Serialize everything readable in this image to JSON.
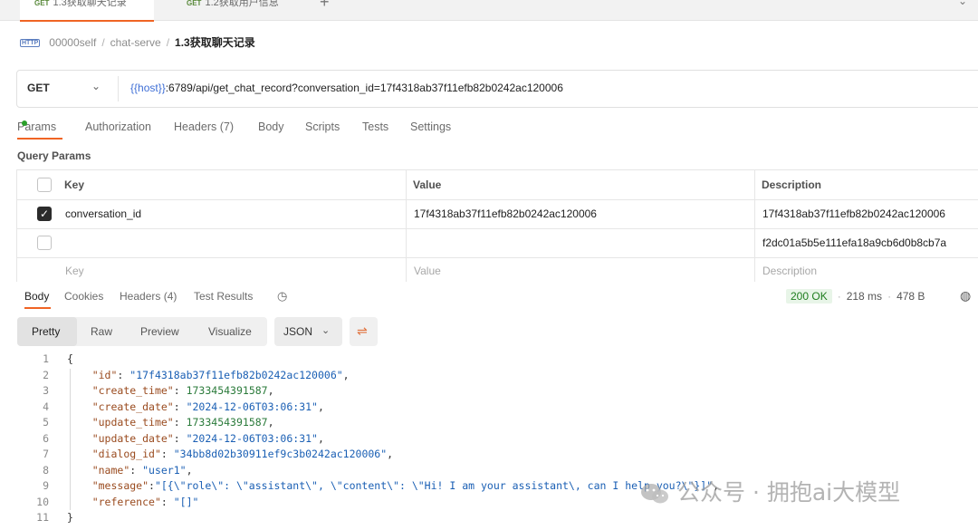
{
  "tabs": [
    {
      "method": "GET",
      "label": "1.3获取聊天记录",
      "active": true
    },
    {
      "method": "GET",
      "label": "1.2获取用户信息",
      "active": false
    }
  ],
  "breadcrumb": {
    "badge": "HTTP",
    "workspace": "00000self",
    "collection": "chat-serve",
    "current": "1.3获取聊天记录",
    "separator": "/"
  },
  "request": {
    "method": "GET",
    "url_var": "{{host}}",
    "url_rest": ":6789/api/get_chat_record?conversation_id=17f4318ab37f11efb82b0242ac120006"
  },
  "request_tabs": [
    "Params",
    "Authorization",
    "Headers (7)",
    "Body",
    "Scripts",
    "Tests",
    "Settings"
  ],
  "query_params": {
    "title": "Query Params",
    "headers": [
      "Key",
      "Value",
      "Description"
    ],
    "rows": [
      {
        "checked": true,
        "key": "conversation_id",
        "value": "17f4318ab37f11efb82b0242ac120006",
        "description": "17f4318ab37f11efb82b0242ac120006"
      },
      {
        "checked": false,
        "key": "",
        "value": "",
        "description": "f2dc01a5b5e111efa18a9cb6d0b8cb7a"
      }
    ],
    "placeholders": [
      "Key",
      "Value",
      "Description"
    ]
  },
  "response_tabs": [
    "Body",
    "Cookies",
    "Headers (4)",
    "Test Results"
  ],
  "response_status": {
    "code": "200 OK",
    "time": "218 ms",
    "size": "478 B"
  },
  "view_modes": [
    "Pretty",
    "Raw",
    "Preview",
    "Visualize"
  ],
  "format": "JSON",
  "code_lines": [
    {
      "n": "1",
      "text": "{"
    },
    {
      "n": "2",
      "key": "\"id\"",
      "val": "\"17f4318ab37f11efb82b0242ac120006\"",
      "type": "s"
    },
    {
      "n": "3",
      "key": "\"create_time\"",
      "val": "1733454391587",
      "type": "n"
    },
    {
      "n": "4",
      "key": "\"create_date\"",
      "val": "\"2024-12-06T03:06:31\"",
      "type": "s"
    },
    {
      "n": "5",
      "key": "\"update_time\"",
      "val": "1733454391587",
      "type": "n"
    },
    {
      "n": "6",
      "key": "\"update_date\"",
      "val": "\"2024-12-06T03:06:31\"",
      "type": "s"
    },
    {
      "n": "7",
      "key": "\"dialog_id\"",
      "val": "\"34bb8d02b30911ef9c3b0242ac120006\"",
      "type": "s"
    },
    {
      "n": "8",
      "key": "\"name\"",
      "val": "\"user1\"",
      "type": "s"
    },
    {
      "n": "9",
      "key": "\"message\"",
      "val": "\"[{\\\"role\\\": \\\"assistant\\\", \\\"content\\\": \\\"Hi! I am your assistant\\, can I help you?\\\"}]\"",
      "type": "s"
    },
    {
      "n": "10",
      "key": "\"reference\"",
      "val": "\"[]\"",
      "type": "s"
    },
    {
      "n": "11",
      "text": "}"
    }
  ],
  "watermark": "公众号 · 拥抱ai大模型",
  "colors": {
    "accent": "#f06424",
    "status_ok": "#1f7d1f",
    "url_var": "#3f6fd6"
  }
}
